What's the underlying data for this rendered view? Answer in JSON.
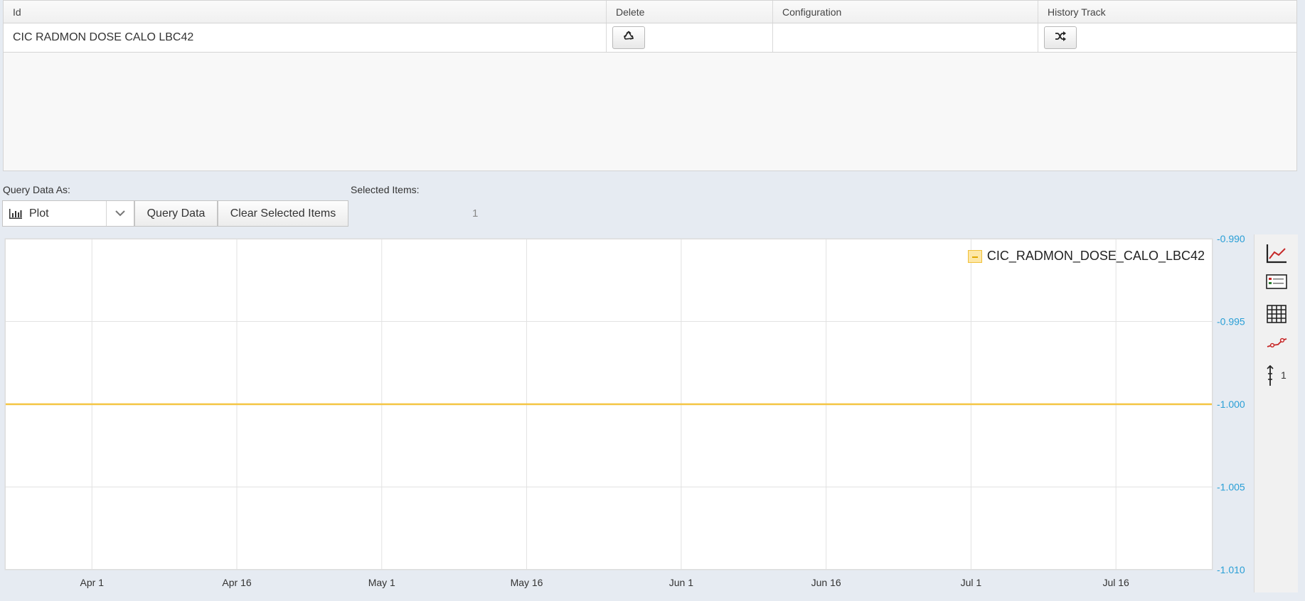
{
  "table": {
    "columns": [
      "Id",
      "Delete",
      "Configuration",
      "History Track"
    ],
    "rows": [
      {
        "id": "CIC RADMON DOSE CALO LBC42",
        "configuration": ""
      }
    ],
    "delete_icon": "recycle-icon",
    "history_icon": "shuffle-icon"
  },
  "controls": {
    "query_as_label": "Query Data As:",
    "query_as_value": "Plot",
    "query_as_icon": "bar-chart-icon",
    "query_button": "Query Data",
    "clear_button": "Clear Selected Items",
    "selected_label": "Selected Items:",
    "selected_count": "1"
  },
  "toolbar": {
    "items": [
      "line-chart-icon",
      "legend-icon",
      "grid-icon",
      "markers-icon",
      "axis-icon"
    ],
    "axis_count": "1"
  },
  "chart_data": {
    "type": "line",
    "x_ticks": [
      "Apr 1",
      "Apr 16",
      "May 1",
      "May 16",
      "Jun 1",
      "Jun 16",
      "Jul 1",
      "Jul 16"
    ],
    "y_ticks": [
      "-0.990",
      "-0.995",
      "-1.000",
      "-1.005",
      "-1.010"
    ],
    "ylim": [
      -1.01,
      -0.99
    ],
    "y_axis_side": "right",
    "grid": true,
    "legend_position": "top-right",
    "series": [
      {
        "name": "CIC_RADMON_DOSE_CALO_LBC42",
        "color": "#f4c542",
        "x": [
          "Mar 23",
          "Jul 26"
        ],
        "y": [
          -1.0,
          -1.0
        ]
      }
    ],
    "axis_label_color": "#2a9fd6"
  }
}
